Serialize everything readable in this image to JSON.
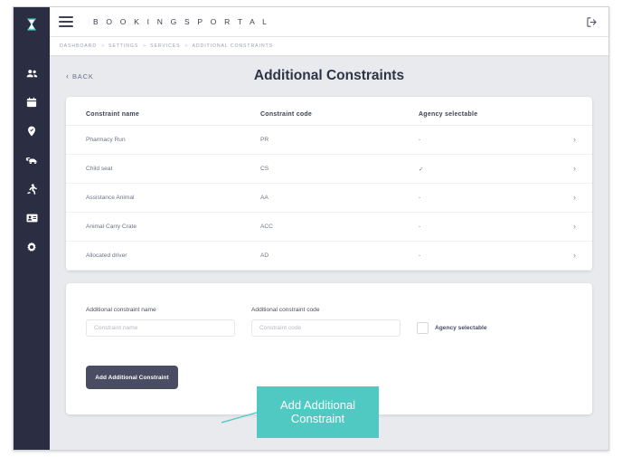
{
  "app": {
    "brand_title": "B O O K I N G S   P O R T A L",
    "menu_icon": "hamburger-icon",
    "logout_icon": "logout-icon",
    "logo_icon": "hourglass-logo-icon"
  },
  "sidebar": {
    "items": [
      {
        "icon": "users-icon",
        "name": "sidebar-item-users"
      },
      {
        "icon": "calendar-icon",
        "name": "sidebar-item-calendar"
      },
      {
        "icon": "location-pin-icon",
        "name": "sidebar-item-locations"
      },
      {
        "icon": "car-icon",
        "name": "sidebar-item-vehicles"
      },
      {
        "icon": "running-person-icon",
        "name": "sidebar-item-activity"
      },
      {
        "icon": "id-card-icon",
        "name": "sidebar-item-drivers"
      },
      {
        "icon": "gear-icon",
        "name": "sidebar-item-settings"
      }
    ]
  },
  "breadcrumb": {
    "items": [
      "DASHBOARD",
      "SETTINGS",
      "SERVICES",
      "ADDITIONAL CONSTRAINTS"
    ],
    "separator": ">"
  },
  "page": {
    "back_label": "BACK",
    "back_chevron": "‹",
    "title": "Additional Constraints"
  },
  "table": {
    "headers": [
      "Constraint name",
      "Constraint code",
      "Agency selectable"
    ],
    "rows": [
      {
        "name": "Pharmacy Run",
        "code": "PR",
        "agency_selectable": "-",
        "chevron": "›"
      },
      {
        "name": "Child seat",
        "code": "CS",
        "agency_selectable": "✓",
        "chevron": "›"
      },
      {
        "name": "Assistance Animal",
        "code": "AA",
        "agency_selectable": "-",
        "chevron": "›"
      },
      {
        "name": "Animal Carry Crate",
        "code": "ACC",
        "agency_selectable": "-",
        "chevron": "›"
      },
      {
        "name": "Allocated driver",
        "code": "AD",
        "agency_selectable": "-",
        "chevron": "›"
      }
    ]
  },
  "form": {
    "name_label": "Additional constraint name",
    "name_value": "",
    "name_placeholder": "Constraint name",
    "code_label": "Additional constraint code",
    "code_value": "",
    "code_placeholder": "Constraint code",
    "checkbox_label": "Agency selectable",
    "checkbox_checked": false,
    "submit_label": "Add Additional Constraint"
  },
  "callout": {
    "line1": "Add Additional",
    "line2": "Constraint",
    "color": "#50c9c3"
  },
  "colors": {
    "sidebar_bg": "#2b2d42",
    "accent_teal": "#50c9c3",
    "button_dark": "#4a4c63",
    "page_bg": "#e8eaed"
  }
}
